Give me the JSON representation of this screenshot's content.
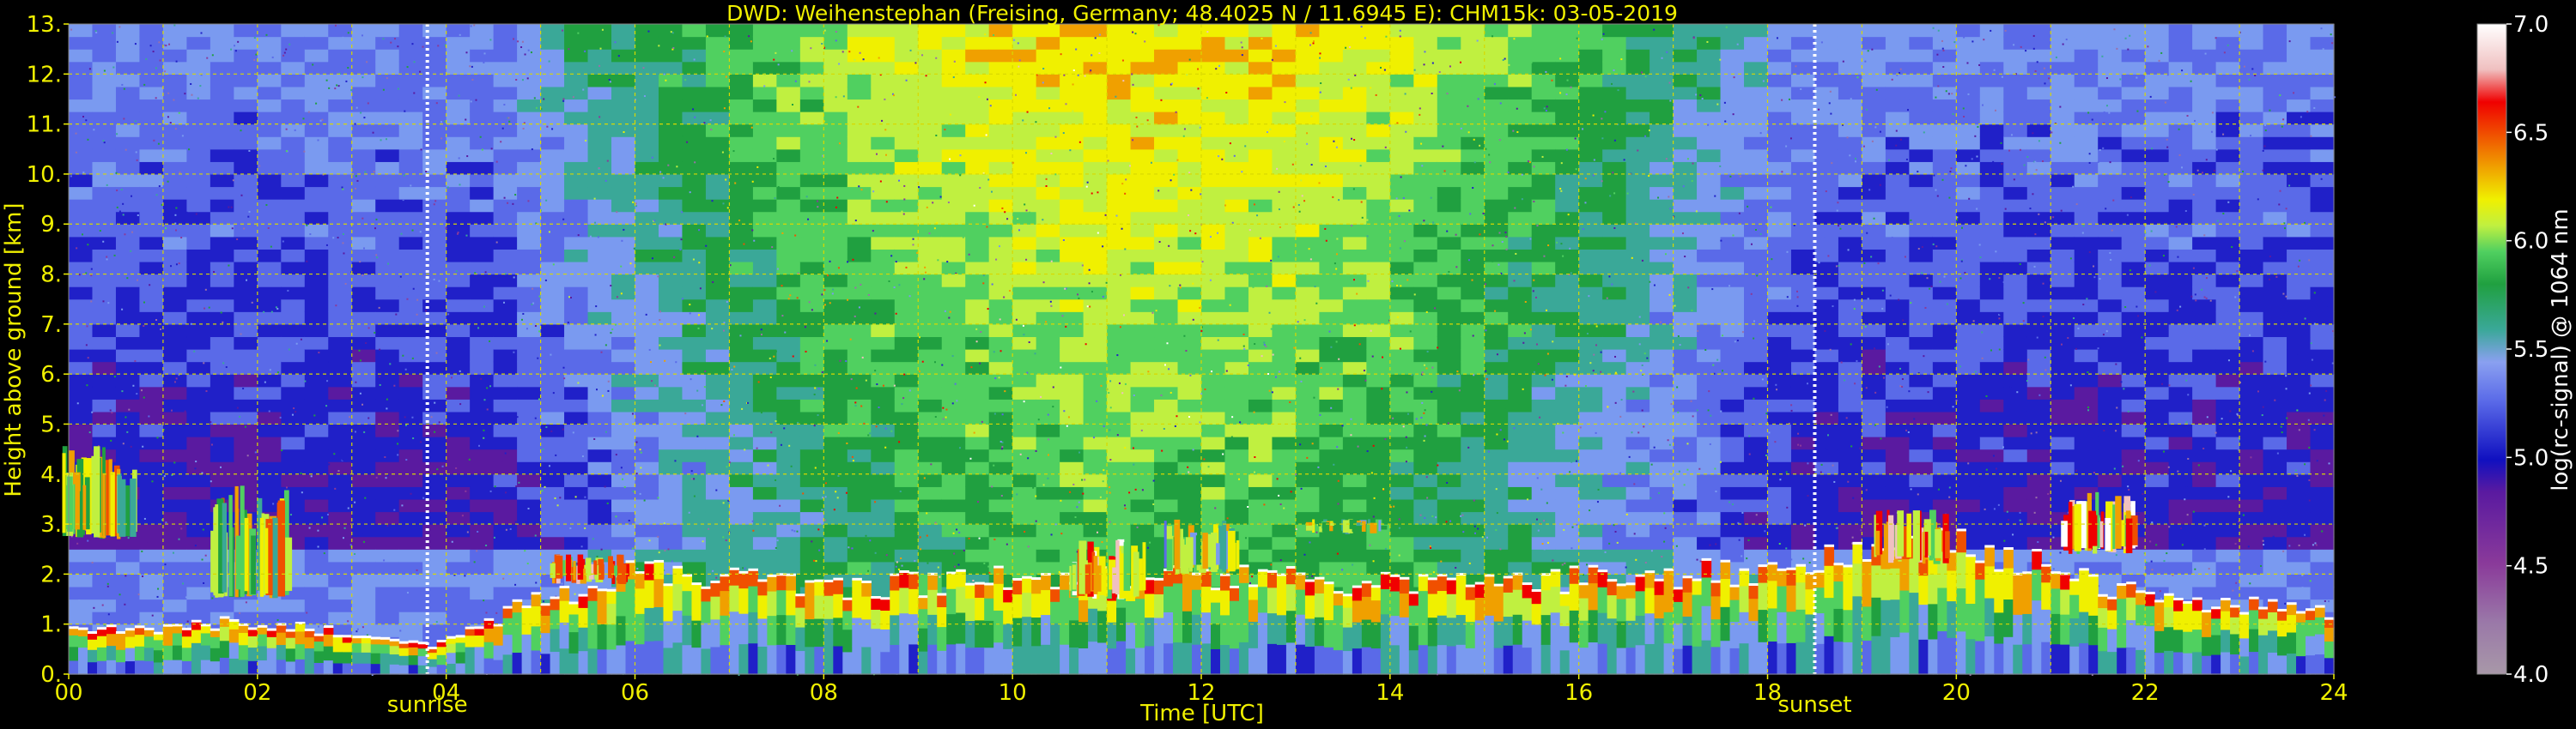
{
  "chart_data": {
    "type": "heatmap",
    "title": "DWD: Weihenstephan (Freising, Germany; 48.4025 N / 11.6945 E):    CHM15k: 03-05-2019",
    "xlabel": "Time [UTC]",
    "ylabel": "Height above ground [km]",
    "xlim": [
      0,
      24
    ],
    "ylim": [
      0,
      13
    ],
    "x_ticks": [
      "00",
      "02",
      "04",
      "06",
      "08",
      "10",
      "12",
      "14",
      "16",
      "18",
      "20",
      "22",
      "24"
    ],
    "y_ticks": [
      "0.",
      "1.",
      "2.",
      "3.",
      "4.",
      "5.",
      "6.",
      "7.",
      "8.",
      "9.",
      "10.",
      "11.",
      "12.",
      "13."
    ],
    "grid": true,
    "colorbar": {
      "label": "log(rc-signal) @ 1064 nm",
      "range": [
        4.0,
        7.0
      ],
      "ticks": [
        "4.0",
        "4.5",
        "5.0",
        "5.5",
        "6.0",
        "6.5",
        "7.0"
      ]
    },
    "annotations": [
      {
        "label": "sunrise",
        "time": 3.8
      },
      {
        "label": "sunset",
        "time": 18.5
      }
    ],
    "cloud_layers": [
      {
        "time": 0.3,
        "base_km": 2.7,
        "top_km": 4.6,
        "intensity": 6.5
      },
      {
        "time": 1.9,
        "base_km": 1.5,
        "top_km": 3.8,
        "intensity": 6.4
      },
      {
        "time": 5.5,
        "base_km": 1.8,
        "top_km": 2.4,
        "intensity": 6.8
      },
      {
        "time": 11.0,
        "base_km": 1.5,
        "top_km": 2.7,
        "intensity": 6.9
      },
      {
        "time": 12.0,
        "base_km": 2.0,
        "top_km": 3.1,
        "intensity": 6.2
      },
      {
        "time": 13.5,
        "base_km": 2.8,
        "top_km": 3.1,
        "intensity": 6.3
      },
      {
        "time": 19.5,
        "base_km": 2.2,
        "top_km": 3.3,
        "intensity": 6.8
      },
      {
        "time": 21.5,
        "base_km": 2.4,
        "top_km": 3.7,
        "intensity": 6.9
      }
    ],
    "boundary_layer_km": [
      {
        "t": 0,
        "h": 0.9
      },
      {
        "t": 2,
        "h": 1.0
      },
      {
        "t": 3.8,
        "h": 0.6
      },
      {
        "t": 5,
        "h": 1.5
      },
      {
        "t": 6,
        "h": 2.0
      },
      {
        "t": 8,
        "h": 1.7
      },
      {
        "t": 10,
        "h": 1.9
      },
      {
        "t": 12,
        "h": 2.0
      },
      {
        "t": 14,
        "h": 1.8
      },
      {
        "t": 16,
        "h": 1.9
      },
      {
        "t": 18,
        "h": 2.1
      },
      {
        "t": 20,
        "h": 2.6
      },
      {
        "t": 22,
        "h": 1.5
      },
      {
        "t": 24,
        "h": 1.2
      }
    ]
  },
  "colors": {
    "text": "#f0f000",
    "grid": "#d8d800",
    "background": "#000000",
    "colorbar_stops": [
      "#a898a8",
      "#9a70a8",
      "#8a3a9a",
      "#5a1aa0",
      "#2020c8",
      "#5a6ae8",
      "#7a9af0",
      "#3aa898",
      "#20a040",
      "#50d060",
      "#c0f040",
      "#f0f000",
      "#f0a000",
      "#f05000",
      "#f00000",
      "#f0c0c0",
      "#ffffff"
    ]
  }
}
